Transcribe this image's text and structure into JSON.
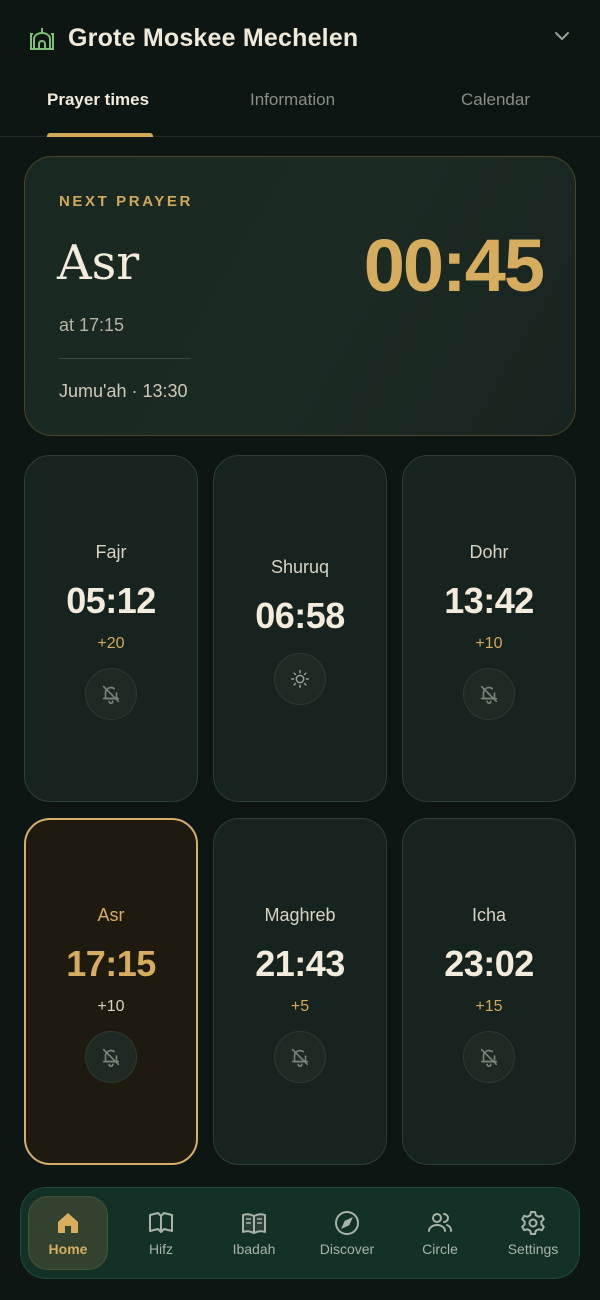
{
  "header": {
    "title": "Grote Moskee Mechelen"
  },
  "tabs": [
    {
      "label": "Prayer times",
      "active": true
    },
    {
      "label": "Information",
      "active": false
    },
    {
      "label": "Calendar",
      "active": false
    }
  ],
  "next_prayer": {
    "label": "NEXT PRAYER",
    "name": "Asr",
    "at": "at 17:15",
    "countdown": "00:45",
    "jumuah": "Jumu'ah · 13:30"
  },
  "prayers": [
    {
      "name": "Fajr",
      "time": "05:12",
      "offset": "+20",
      "icon": "bell-off-icon"
    },
    {
      "name": "Shuruq",
      "time": "06:58",
      "offset": "",
      "icon": "sun-icon"
    },
    {
      "name": "Dohr",
      "time": "13:42",
      "offset": "+10",
      "icon": "bell-off-icon"
    },
    {
      "name": "Asr",
      "time": "17:15",
      "offset": "+10",
      "icon": "bell-off-icon",
      "current": true
    },
    {
      "name": "Maghreb",
      "time": "21:43",
      "offset": "+5",
      "icon": "bell-off-icon"
    },
    {
      "name": "Icha",
      "time": "23:02",
      "offset": "+15",
      "icon": "bell-off-icon"
    }
  ],
  "nav": [
    {
      "label": "Home",
      "icon": "home-icon",
      "active": true
    },
    {
      "label": "Hifz",
      "icon": "open-book-icon"
    },
    {
      "label": "Ibadah",
      "icon": "book-icon"
    },
    {
      "label": "Discover",
      "icon": "compass-icon"
    },
    {
      "label": "Circle",
      "icon": "people-icon"
    },
    {
      "label": "Settings",
      "icon": "gear-icon"
    }
  ],
  "colors": {
    "accent": "#d2a85b",
    "background": "#0d1612",
    "card": "#17231e"
  }
}
